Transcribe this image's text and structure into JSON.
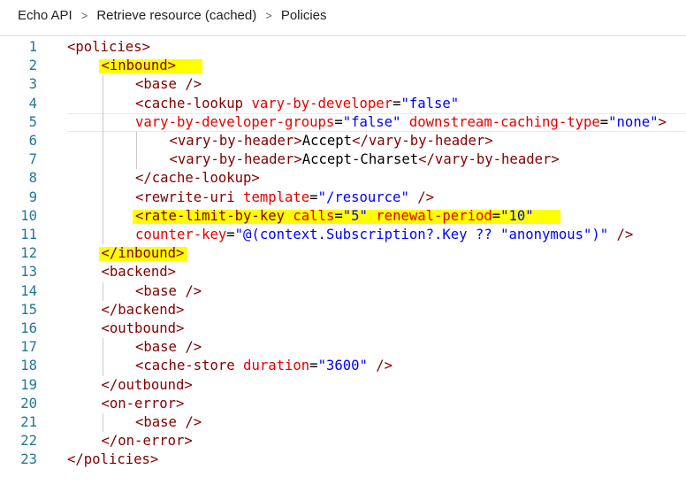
{
  "breadcrumb": {
    "items": [
      "Echo API",
      "Retrieve resource (cached)",
      "Policies"
    ],
    "separator": ">"
  },
  "editor": {
    "colors": {
      "tag": "#800000",
      "attribute": "#e50000",
      "value": "#0000ff",
      "text": "#000000",
      "line_number": "#237893",
      "highlight": "#ffff00"
    },
    "highlighted_lines": [
      2,
      10,
      12
    ],
    "current_line": 5,
    "lines": [
      {
        "n": "1",
        "indent": 0,
        "tokens": [
          {
            "t": "<policies>",
            "c": "tag"
          }
        ]
      },
      {
        "n": "2",
        "indent": 1,
        "tokens": [
          {
            "t": "<inbound>",
            "c": "tag"
          }
        ]
      },
      {
        "n": "3",
        "indent": 2,
        "tokens": [
          {
            "t": "<base />",
            "c": "tag"
          }
        ]
      },
      {
        "n": "4",
        "indent": 2,
        "tokens": [
          {
            "t": "<cache-lookup",
            "c": "tag"
          },
          {
            "t": " vary-by-developer",
            "c": "attr"
          },
          {
            "t": "=",
            "c": "txt"
          },
          {
            "t": "\"false\"",
            "c": "val"
          }
        ]
      },
      {
        "n": "5",
        "indent": 2,
        "tokens": [
          {
            "t": "vary-by-developer-groups",
            "c": "attr"
          },
          {
            "t": "=",
            "c": "txt"
          },
          {
            "t": "\"false\"",
            "c": "val"
          },
          {
            "t": " downstream-caching-type",
            "c": "attr"
          },
          {
            "t": "=",
            "c": "txt"
          },
          {
            "t": "\"none\"",
            "c": "val"
          },
          {
            "t": ">",
            "c": "tag"
          }
        ]
      },
      {
        "n": "6",
        "indent": 3,
        "tokens": [
          {
            "t": "<vary-by-header>",
            "c": "tag"
          },
          {
            "t": "Accept",
            "c": "txt"
          },
          {
            "t": "</vary-by-header>",
            "c": "tag"
          }
        ]
      },
      {
        "n": "7",
        "indent": 3,
        "tokens": [
          {
            "t": "<vary-by-header>",
            "c": "tag"
          },
          {
            "t": "Accept-Charset",
            "c": "txt"
          },
          {
            "t": "</vary-by-header>",
            "c": "tag"
          }
        ]
      },
      {
        "n": "8",
        "indent": 2,
        "tokens": [
          {
            "t": "</cache-lookup>",
            "c": "tag"
          }
        ]
      },
      {
        "n": "9",
        "indent": 2,
        "tokens": [
          {
            "t": "<rewrite-uri",
            "c": "tag"
          },
          {
            "t": " template",
            "c": "attr"
          },
          {
            "t": "=",
            "c": "txt"
          },
          {
            "t": "\"/resource\"",
            "c": "val"
          },
          {
            "t": " />",
            "c": "tag"
          }
        ]
      },
      {
        "n": "10",
        "indent": 2,
        "tokens": [
          {
            "t": "<rate-limit-by-key",
            "c": "tag"
          },
          {
            "t": " calls",
            "c": "attr"
          },
          {
            "t": "=",
            "c": "txt"
          },
          {
            "t": "\"5\"",
            "c": "val"
          },
          {
            "t": " renewal-period",
            "c": "attr"
          },
          {
            "t": "=",
            "c": "txt"
          },
          {
            "t": "\"10\"",
            "c": "val"
          }
        ]
      },
      {
        "n": "11",
        "indent": 2,
        "tokens": [
          {
            "t": "counter-key",
            "c": "attr"
          },
          {
            "t": "=",
            "c": "txt"
          },
          {
            "t": "\"@(context.Subscription?.Key ?? \"anonymous\")\"",
            "c": "val"
          },
          {
            "t": " />",
            "c": "tag"
          }
        ]
      },
      {
        "n": "12",
        "indent": 1,
        "tokens": [
          {
            "t": "</inbound>",
            "c": "tag"
          }
        ]
      },
      {
        "n": "13",
        "indent": 1,
        "tokens": [
          {
            "t": "<backend>",
            "c": "tag"
          }
        ]
      },
      {
        "n": "14",
        "indent": 2,
        "tokens": [
          {
            "t": "<base />",
            "c": "tag"
          }
        ]
      },
      {
        "n": "15",
        "indent": 1,
        "tokens": [
          {
            "t": "</backend>",
            "c": "tag"
          }
        ]
      },
      {
        "n": "16",
        "indent": 1,
        "tokens": [
          {
            "t": "<outbound>",
            "c": "tag"
          }
        ]
      },
      {
        "n": "17",
        "indent": 2,
        "tokens": [
          {
            "t": "<base />",
            "c": "tag"
          }
        ]
      },
      {
        "n": "18",
        "indent": 2,
        "tokens": [
          {
            "t": "<cache-store",
            "c": "tag"
          },
          {
            "t": " duration",
            "c": "attr"
          },
          {
            "t": "=",
            "c": "txt"
          },
          {
            "t": "\"3600\"",
            "c": "val"
          },
          {
            "t": " />",
            "c": "tag"
          }
        ]
      },
      {
        "n": "19",
        "indent": 1,
        "tokens": [
          {
            "t": "</outbound>",
            "c": "tag"
          }
        ]
      },
      {
        "n": "20",
        "indent": 1,
        "tokens": [
          {
            "t": "<on-error>",
            "c": "tag"
          }
        ]
      },
      {
        "n": "21",
        "indent": 2,
        "tokens": [
          {
            "t": "<base />",
            "c": "tag"
          }
        ]
      },
      {
        "n": "22",
        "indent": 1,
        "tokens": [
          {
            "t": "</on-error>",
            "c": "tag"
          }
        ]
      },
      {
        "n": "23",
        "indent": 0,
        "tokens": [
          {
            "t": "</policies>",
            "c": "tag"
          }
        ]
      }
    ]
  }
}
